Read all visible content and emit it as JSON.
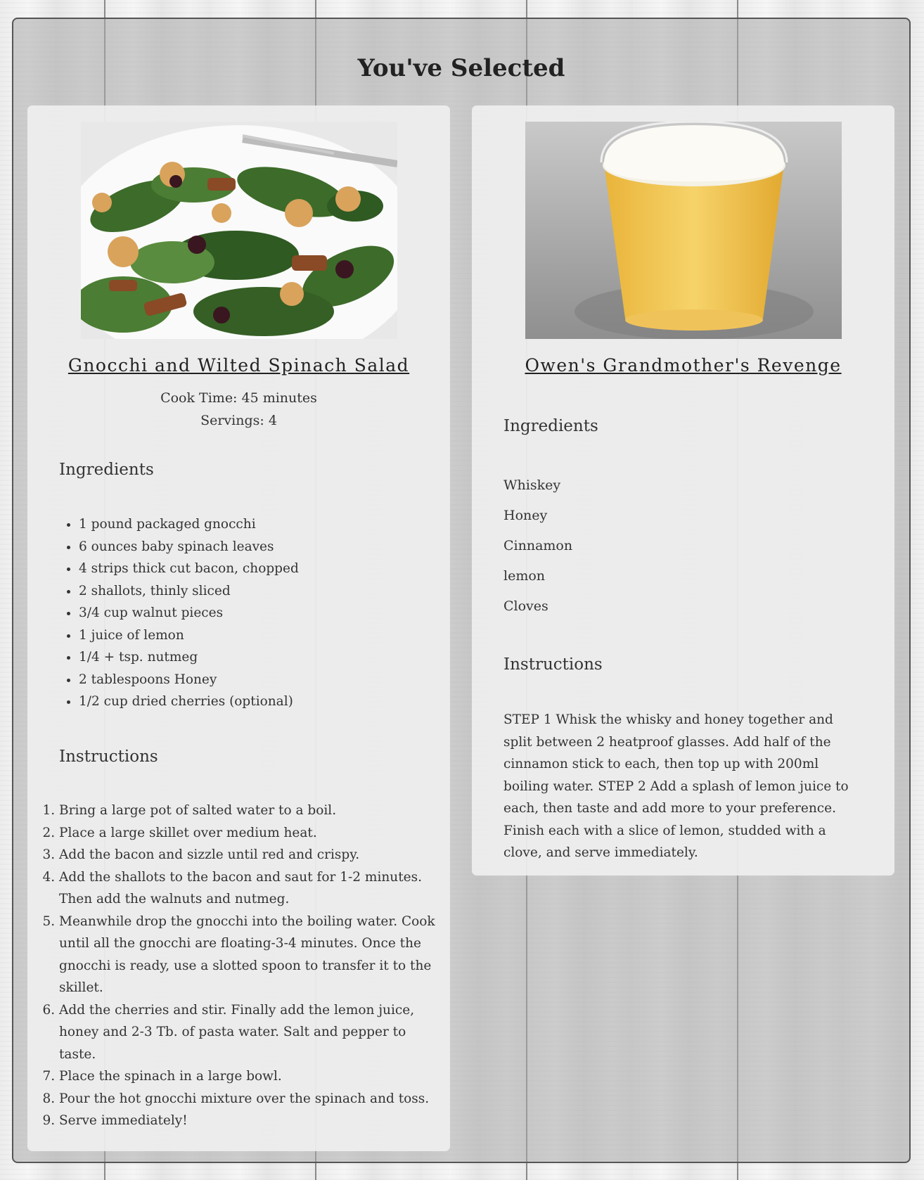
{
  "page": {
    "title": "You've Selected"
  },
  "recipes": [
    {
      "name": "Gnocchi and Wilted Spinach Salad",
      "cook_time": "Cook Time: 45 minutes",
      "servings": "Servings: 4",
      "ingredients_heading": "Ingredients",
      "ingredients": [
        "1 pound packaged gnocchi",
        "6 ounces baby spinach leaves",
        "4 strips thick cut bacon, chopped",
        "2 shallots, thinly sliced",
        "3/4 cup walnut pieces",
        "1 juice of lemon",
        "1/4 + tsp. nutmeg",
        "2 tablespoons Honey",
        "1/2 cup dried cherries (optional)"
      ],
      "instructions_heading": "Instructions",
      "instructions": [
        "Bring a large pot of salted water to a boil.",
        "Place a large skillet over medium heat.",
        "Add the bacon and sizzle until red and crispy.",
        "Add the shallots to the bacon and saut for 1-2 minutes. Then add the walnuts and nutmeg.",
        "Meanwhile drop the gnocchi into the boiling water. Cook until all the gnocchi are floating-3-4 minutes. Once the gnocchi is ready, use a slotted spoon to transfer it to the skillet.",
        "Add the cherries and stir. Finally add the lemon juice, honey and 2-3 Tb. of pasta water. Salt and pepper to taste.",
        "Place the spinach in a large bowl.",
        "Pour the hot gnocchi mixture over the spinach and toss.",
        "Serve immediately!"
      ]
    },
    {
      "name": "Owen's Grandmother's Revenge",
      "ingredients_heading": "Ingredients",
      "ingredients": [
        "Whiskey",
        "Honey",
        "Cinnamon",
        "lemon",
        "Cloves"
      ],
      "instructions_heading": "Instructions",
      "instructions_text": "STEP 1 Whisk the whisky and honey together and split between 2 heatproof glasses. Add half of the cinnamon stick to each, then top up with 200ml boiling water. STEP 2 Add a splash of lemon juice to each, then taste and add more to your preference. Finish each with a slice of lemon, studded with a clove, and serve immediately."
    }
  ]
}
